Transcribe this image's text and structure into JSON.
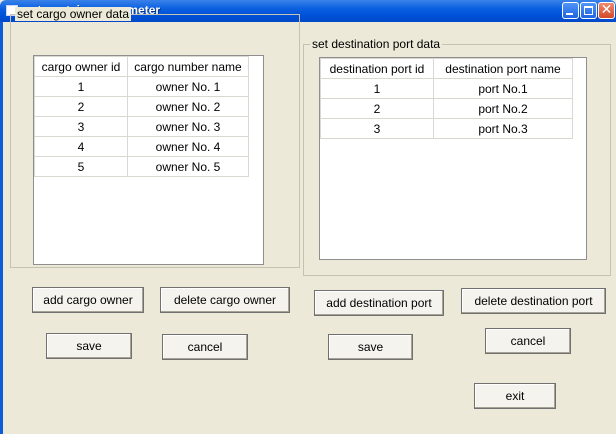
{
  "window": {
    "title": "set container parameter",
    "icons": [
      "app-icon",
      "minimize-icon",
      "maximize-icon",
      "close-icon"
    ],
    "close_glyph": "✕"
  },
  "owner_group": {
    "legend": "set cargo owner data",
    "columns": [
      "cargo owner id",
      "cargo number name"
    ],
    "rows": [
      [
        "1",
        "owner No. 1"
      ],
      [
        "2",
        "owner No. 2"
      ],
      [
        "3",
        "owner No. 3"
      ],
      [
        "4",
        "owner No. 4"
      ],
      [
        "5",
        "owner No. 5"
      ]
    ]
  },
  "port_group": {
    "legend": "set destination port data",
    "columns": [
      "destination port id",
      "destination port name"
    ],
    "rows": [
      [
        "1",
        "port No.1"
      ],
      [
        "2",
        "port No.2"
      ],
      [
        "3",
        "port No.3"
      ]
    ]
  },
  "buttons": {
    "add_owner": "add cargo owner",
    "delete_owner": "delete cargo owner",
    "add_port": "add destination port",
    "delete_port": "delete destination port",
    "save_owner": "save",
    "cancel_owner": "cancel",
    "save_port": "save",
    "cancel_port": "cancel",
    "exit": "exit"
  },
  "colors": {
    "titlebar": "#0a5fe0",
    "window_bg": "#ece9d8",
    "close_button": "#d3492a"
  }
}
